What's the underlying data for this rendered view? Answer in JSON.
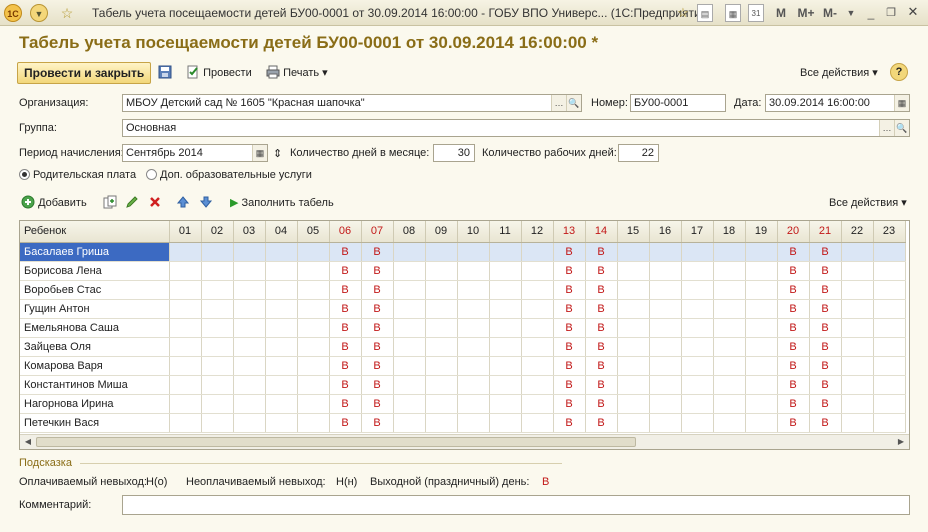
{
  "window": {
    "app_logo": "1С",
    "title": "Табель учета посещаемости детей БУ00-0001 от 30.09.2014 16:00:00 - ГОБУ ВПО Универс...  (1С:Предприятие)",
    "m_labels": [
      "M",
      "M+",
      "M-"
    ]
  },
  "doc": {
    "title": "Табель учета посещаемости детей БУ00-0001 от 30.09.2014 16:00:00 *"
  },
  "toolbar": {
    "post_close": "Провести и закрыть",
    "post": "Провести",
    "print": "Печать",
    "all_actions": "Все действия",
    "help": "?"
  },
  "form": {
    "org_label": "Организация:",
    "org_value": "МБОУ Детский сад № 1605 \"Красная шапочка\"",
    "number_label": "Номер:",
    "number_value": "БУ00-0001",
    "date_label": "Дата:",
    "date_value": "30.09.2014 16:00:00",
    "group_label": "Группа:",
    "group_value": "Основная",
    "period_label": "Период начисления:",
    "period_value": "Сентябрь 2014",
    "days_month_label": "Количество дней в месяце:",
    "days_month_value": "30",
    "work_days_label": "Количество рабочих дней:",
    "work_days_value": "22",
    "radio_parent": "Родительская плата",
    "radio_extra": "Доп. образовательные услуги"
  },
  "grid_toolbar": {
    "add": "Добавить",
    "fill": "Заполнить табель",
    "all_actions": "Все действия"
  },
  "grid": {
    "name_header": "Ребенок",
    "days": [
      "01",
      "02",
      "03",
      "04",
      "05",
      "06",
      "07",
      "08",
      "09",
      "10",
      "11",
      "12",
      "13",
      "14",
      "15",
      "16",
      "17",
      "18",
      "19",
      "20",
      "21",
      "22",
      "23"
    ],
    "weekend_days": [
      "06",
      "07",
      "13",
      "14",
      "20",
      "21"
    ],
    "weekend_mark": "В",
    "rows": [
      "Басалаев Гриша",
      "Борисова Лена",
      "Воробьев Стас",
      "Гущин Антон",
      "Емельянова Саша",
      "Зайцева Оля",
      "Комарова Варя",
      "Константинов Миша",
      "Нагорнова Ирина",
      "Петечкин Вася"
    ]
  },
  "hint": {
    "title": "Подсказка",
    "paid": "Оплачиваемый невыход:",
    "paid_code": "Н(о)",
    "unpaid": "Неоплачиваемый невыход:",
    "unpaid_code": "Н(н)",
    "weekend": "Выходной (праздничный) день:",
    "weekend_code": "В"
  },
  "comment": {
    "label": "Комментарий:",
    "value": ""
  },
  "colors": {
    "accent": "#8a6d17",
    "weekend": "#c21818",
    "selection": "#3c6ac2"
  }
}
